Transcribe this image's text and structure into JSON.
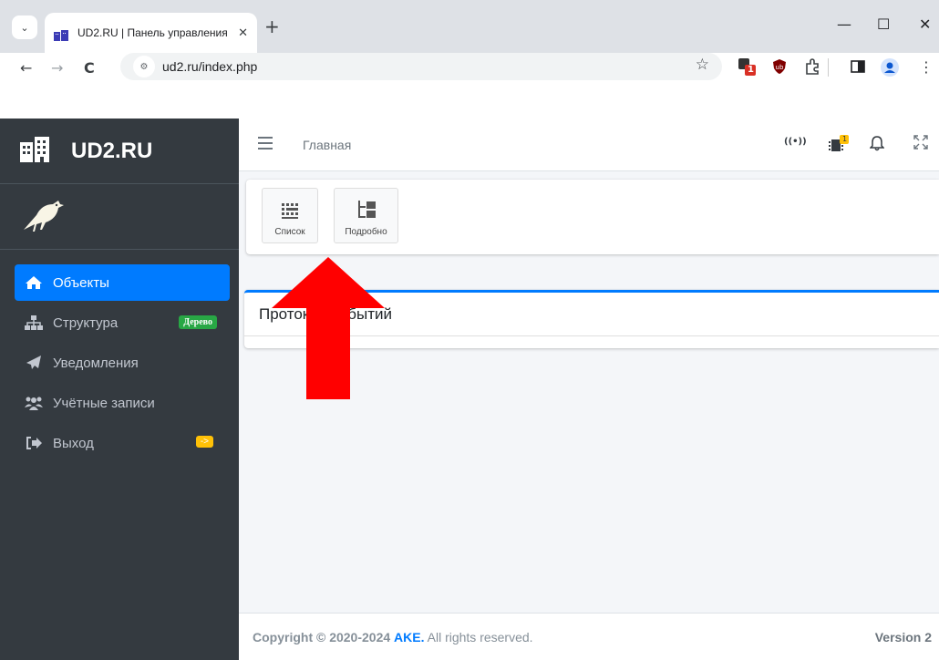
{
  "browser": {
    "tab_title": "UD2.RU | Панель управления",
    "tab_close": "✕",
    "new_tab": "+",
    "address": "ud2.ru/index.php",
    "window": {
      "minimize": "—",
      "maximize": "☐",
      "close": "✕"
    },
    "nav": {
      "back": "←",
      "forward": "→",
      "reload": "C"
    },
    "extension_badge": "1"
  },
  "sidebar": {
    "brand": "UD2.RU",
    "items": [
      {
        "label": "Объекты",
        "icon": "home-icon",
        "active": true
      },
      {
        "label": "Структура",
        "icon": "sitemap-icon",
        "badge": "Дерево"
      },
      {
        "label": "Уведомления",
        "icon": "paper-plane-icon"
      },
      {
        "label": "Учётные записи",
        "icon": "users-icon"
      },
      {
        "label": "Выход",
        "icon": "sign-out-icon",
        "badge": "->"
      }
    ]
  },
  "topnav": {
    "breadcrumb": "Главная",
    "signal_icon_text": "((•))",
    "device_badge": "1"
  },
  "toolbar": {
    "buttons": [
      {
        "label": "Список",
        "icon": "grid-list-icon"
      },
      {
        "label": "Подробно",
        "icon": "tree-detail-icon"
      }
    ]
  },
  "events_card": {
    "title": "Протокол событий"
  },
  "footer": {
    "copyright_prefix": "Copyright © 2020-2024 ",
    "company": "AKE.",
    "rights": " All rights reserved.",
    "version": "Version 2"
  },
  "colors": {
    "sidebar_bg": "#343a40",
    "active_blue": "#007bff",
    "badge_green": "#28a745",
    "badge_yellow": "#ffc107",
    "arrow_red": "#ff0000"
  }
}
